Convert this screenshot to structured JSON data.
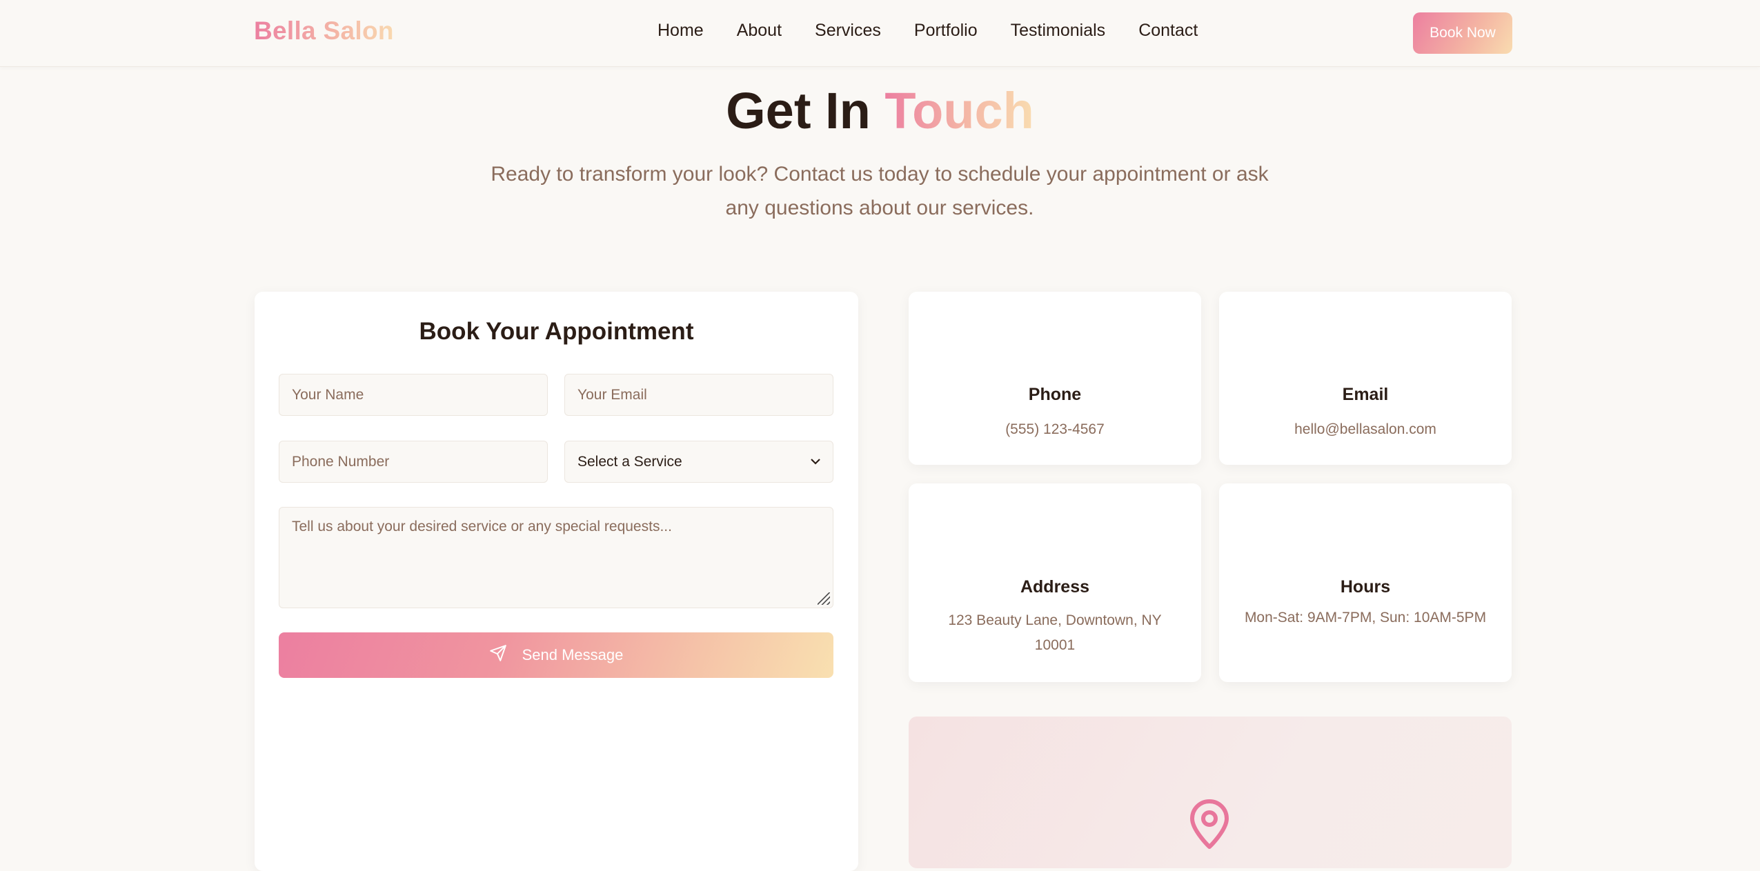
{
  "colors": {
    "background": "#faf8f5",
    "text_dark": "#2b1d16",
    "text_muted": "#8a6c5c",
    "accent_pink": "#ec7fa0",
    "accent_peach": "#f9dcb0"
  },
  "nav": {
    "brand": "Bella Salon",
    "links": [
      "Home",
      "About",
      "Services",
      "Portfolio",
      "Testimonials",
      "Contact"
    ],
    "cta": "Book Now"
  },
  "hero": {
    "title_main": "Get In",
    "title_accent": "Touch",
    "subtitle": "Ready to transform your look? Contact us today to schedule your appointment or ask any questions about our services."
  },
  "form": {
    "title": "Book Your Appointment",
    "name_placeholder": "Your Name",
    "email_placeholder": "Your Email",
    "phone_placeholder": "Phone Number",
    "service_selected": "Select a Service",
    "message_placeholder": "Tell us about your desired service or any special requests...",
    "send_label": "Send Message",
    "send_icon": "send-icon"
  },
  "contact_cards": {
    "phone": {
      "title": "Phone",
      "value": "(555) 123-4567"
    },
    "email": {
      "title": "Email",
      "value": "hello@bellasalon.com"
    },
    "address": {
      "title": "Address",
      "value": "123 Beauty Lane, Downtown, NY 10001"
    },
    "hours": {
      "title": "Hours",
      "value": "Mon-Sat: 9AM-7PM, Sun: 10AM-5PM"
    }
  },
  "map": {
    "icon": "map-pin-icon"
  }
}
